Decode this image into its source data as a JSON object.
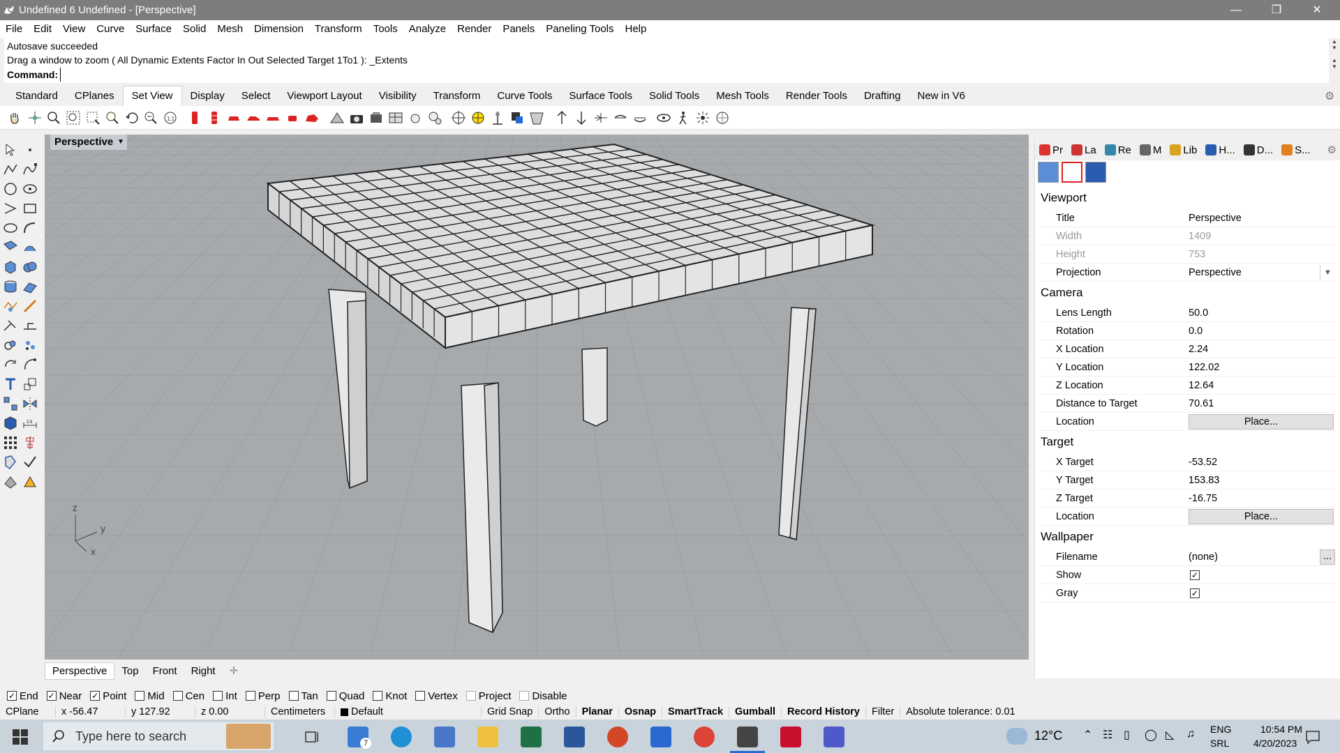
{
  "window": {
    "title": "Undefined 6 Undefined - [Perspective]",
    "min_icon": "minimize-icon",
    "max_icon": "restore-icon",
    "close_icon": "close-icon"
  },
  "menu": [
    "File",
    "Edit",
    "View",
    "Curve",
    "Surface",
    "Solid",
    "Mesh",
    "Dimension",
    "Transform",
    "Tools",
    "Analyze",
    "Render",
    "Panels",
    "Paneling Tools",
    "Help"
  ],
  "command": {
    "line1": "Autosave succeeded",
    "line2": "Drag a window to zoom ( All  Dynamic  Extents  Factor  In  Out  Selected  Target  1To1 ): _Extents",
    "prompt": "Command:"
  },
  "tabs": [
    "Standard",
    "CPlanes",
    "Set View",
    "Display",
    "Select",
    "Viewport Layout",
    "Visibility",
    "Transform",
    "Curve Tools",
    "Surface Tools",
    "Solid Tools",
    "Mesh Tools",
    "Render Tools",
    "Drafting",
    "New in V6"
  ],
  "active_tab": "Set View",
  "viewport": {
    "label": "Perspective",
    "axis_z": "z",
    "axis_y": "y",
    "axis_x": "x"
  },
  "viewport_tabs": [
    "Perspective",
    "Top",
    "Front",
    "Right"
  ],
  "panel": {
    "tabs": [
      {
        "label": "Pr",
        "icon": "properties-icon",
        "color": "#d33"
      },
      {
        "label": "La",
        "icon": "layers-icon",
        "color": "#c33"
      },
      {
        "label": "Re",
        "icon": "render-icon",
        "color": "#38a"
      },
      {
        "label": "M",
        "icon": "materials-icon",
        "color": "#666"
      },
      {
        "label": "Lib",
        "icon": "libraries-icon",
        "color": "#d9a520"
      },
      {
        "label": "H...",
        "icon": "help-icon",
        "color": "#2a5cb0"
      },
      {
        "label": "D...",
        "icon": "display-icon",
        "color": "#333"
      },
      {
        "label": "S...",
        "icon": "sun-icon",
        "color": "#e08020"
      }
    ],
    "viewport_title": "Viewport",
    "viewport_rows": [
      {
        "label": "Title",
        "value": "Perspective"
      },
      {
        "label": "Width",
        "value": "1409"
      },
      {
        "label": "Height",
        "value": "753"
      },
      {
        "label": "Projection",
        "value": "Perspective"
      }
    ],
    "camera_title": "Camera",
    "camera_rows": [
      {
        "label": "Lens Length",
        "value": "50.0"
      },
      {
        "label": "Rotation",
        "value": "0.0"
      },
      {
        "label": "X Location",
        "value": "2.24"
      },
      {
        "label": "Y Location",
        "value": "122.02"
      },
      {
        "label": "Z Location",
        "value": "12.64"
      },
      {
        "label": "Distance to Target",
        "value": "70.61"
      },
      {
        "label": "Location",
        "value": "Place..."
      }
    ],
    "target_title": "Target",
    "target_rows": [
      {
        "label": "X Target",
        "value": "-53.52"
      },
      {
        "label": "Y Target",
        "value": "153.83"
      },
      {
        "label": "Z Target",
        "value": "-16.75"
      },
      {
        "label": "Location",
        "value": "Place..."
      }
    ],
    "wallpaper_title": "Wallpaper",
    "wallpaper_rows": [
      {
        "label": "Filename",
        "value": "(none)",
        "button": "..."
      },
      {
        "label": "Show",
        "checked": true
      },
      {
        "label": "Gray",
        "checked": true
      }
    ]
  },
  "osnaps": [
    {
      "label": "End",
      "checked": true
    },
    {
      "label": "Near",
      "checked": true
    },
    {
      "label": "Point",
      "checked": true
    },
    {
      "label": "Mid",
      "checked": false
    },
    {
      "label": "Cen",
      "checked": false
    },
    {
      "label": "Int",
      "checked": false
    },
    {
      "label": "Perp",
      "checked": false
    },
    {
      "label": "Tan",
      "checked": false
    },
    {
      "label": "Quad",
      "checked": false
    },
    {
      "label": "Knot",
      "checked": false
    },
    {
      "label": "Vertex",
      "checked": false
    },
    {
      "label": "Project",
      "checked": false
    },
    {
      "label": "Disable",
      "checked": false
    }
  ],
  "status": {
    "cplane": "CPlane",
    "x": "x -56.47",
    "y": "y 127.92",
    "z": "z 0.00",
    "units": "Centimeters",
    "layer": "Default",
    "grid_snap": "Grid Snap",
    "ortho": "Ortho",
    "planar": "Planar",
    "osnap": "Osnap",
    "smarttrack": "SmartTrack",
    "gumball": "Gumball",
    "record_history": "Record History",
    "filter": "Filter",
    "tolerance": "Absolute tolerance: 0.01"
  },
  "taskbar": {
    "search_placeholder": "Type here to search",
    "mail_badge": "7",
    "weather": "12°C",
    "lang1": "ENG",
    "lang2": "SRL",
    "time": "10:54 PM",
    "date": "4/20/2023"
  }
}
